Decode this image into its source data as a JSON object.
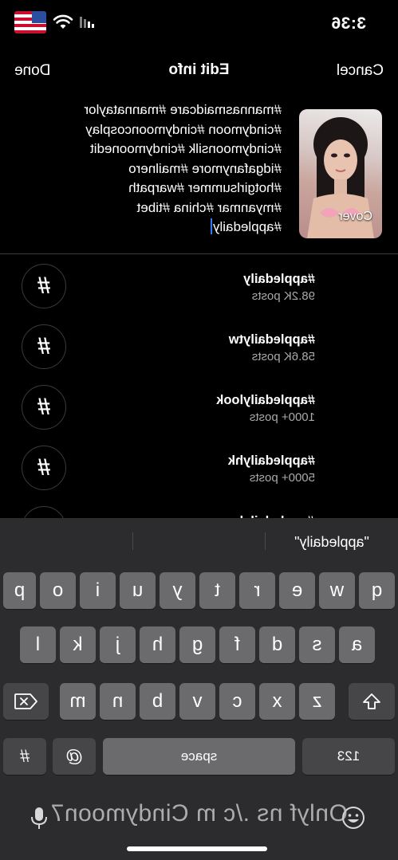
{
  "status": {
    "time": "3:36"
  },
  "nav": {
    "cancel": "Cancel",
    "title": "Edit info",
    "done": "Done"
  },
  "cover": {
    "label": "Cover"
  },
  "caption": {
    "lines": [
      "#mannasmaidcare #mannataylor",
      "#cindymoon #cindymooncosplay",
      "#cindymoonsilk #cindymoonedit",
      "#idgafanymore #mailnero",
      "#hotgirlsummer #warpath",
      "#myanmar #china #tibet",
      "#appledaily"
    ]
  },
  "suggestions": [
    {
      "tag": "#appledaily",
      "posts": "98.2K posts"
    },
    {
      "tag": "#appledailytw",
      "posts": "58.6K posts"
    },
    {
      "tag": "#appledailylook",
      "posts": "1000+ posts"
    },
    {
      "tag": "#appledailyhk",
      "posts": "5000+ posts"
    },
    {
      "tag": "#appledailyhome",
      "posts": ""
    }
  ],
  "keyboard": {
    "prediction": "\"appledaily\"",
    "row1": [
      "q",
      "w",
      "e",
      "r",
      "t",
      "y",
      "u",
      "i",
      "o",
      "p"
    ],
    "row2": [
      "a",
      "s",
      "d",
      "f",
      "g",
      "h",
      "j",
      "k",
      "l"
    ],
    "row3": [
      "z",
      "x",
      "c",
      "v",
      "b",
      "n",
      "m"
    ],
    "numbers_key": "123",
    "space_key": "space",
    "at_key": "@",
    "hash_key": "#"
  },
  "watermark": "Onlyf ns ./c m Cindymoon7",
  "icons": [
    "flag-icon",
    "wifi-icon",
    "signal-icon",
    "shift-icon",
    "backspace-icon",
    "emoji-icon",
    "microphone-icon"
  ],
  "colors": {
    "background": "#000000",
    "keyboard": "#2c2c2e",
    "key": "#6b6b6d",
    "cursor": "#2d7cf6"
  }
}
